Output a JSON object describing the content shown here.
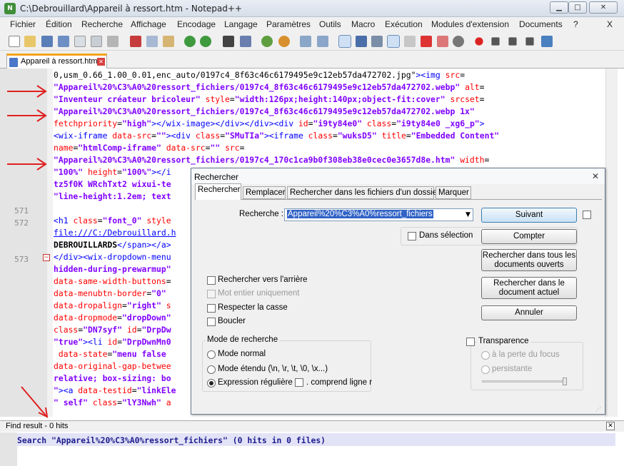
{
  "window": {
    "title": "C:\\Debrouillard\\Appareil à ressort.htm - Notepad++",
    "app_icon": "notepad-plus-plus-icon",
    "buttons": {
      "minimize": "▁",
      "maximize": "□",
      "close": "✕"
    }
  },
  "menu": [
    "Fichier",
    "Édition",
    "Recherche",
    "Affichage",
    "Encodage",
    "Langage",
    "Paramètres",
    "Outils",
    "Macro",
    "Exécution",
    "Modules d'extension",
    "Documents",
    "?"
  ],
  "menu_close": "X",
  "tabs": [
    {
      "label": "Appareil à ressort.htm",
      "close": "✕"
    }
  ],
  "gutter": [
    {
      "line": 7,
      "num": "571"
    },
    {
      "line": 8,
      "num": "572"
    },
    {
      "line": 10,
      "num": "573"
    }
  ],
  "editor": {
    "lines": [
      [
        {
          "t": "0,usm_0.66_1.00_0.01,enc_auto/0197c4_8f63c46c6179495e9c12eb57da472702.jpg\"",
          "c": "#000000"
        },
        {
          "t": "><img ",
          "c": "#0000ff"
        },
        {
          "t": "src",
          "c": "#ff0000"
        },
        {
          "t": "=",
          "c": "#000000"
        }
      ],
      [
        {
          "t": "\"Appareil%20%C3%A0%20ressort_fichiers/0197c4_8f63c46c6179495e9c12eb57da472702.webp\" ",
          "c": "#8000ff",
          "b": true
        },
        {
          "t": "alt",
          "c": "#ff0000"
        },
        {
          "t": "=",
          "c": "#000000"
        }
      ],
      [
        {
          "t": "\"Inventeur créateur bricoleur\" ",
          "c": "#8000ff",
          "b": true
        },
        {
          "t": "style",
          "c": "#ff0000"
        },
        {
          "t": "=",
          "c": "#000000"
        },
        {
          "t": "\"width:126px;height:140px;object-fit:cover\" ",
          "c": "#8000ff",
          "b": true
        },
        {
          "t": "srcset",
          "c": "#ff0000"
        },
        {
          "t": "=",
          "c": "#000000"
        }
      ],
      [
        {
          "t": "\"Appareil%20%C3%A0%20ressort_fichiers/0197c4_8f63c46c6179495e9c12eb57da472702.webp 1x\"",
          "c": "#8000ff",
          "b": true
        }
      ],
      [
        {
          "t": "fetchpriority",
          "c": "#ff0000"
        },
        {
          "t": "=",
          "c": "#000000"
        },
        {
          "t": "\"high\"",
          "c": "#8000ff",
          "b": true
        },
        {
          "t": "></wix-image></div></div><div ",
          "c": "#0000ff"
        },
        {
          "t": "id",
          "c": "#ff0000"
        },
        {
          "t": "=",
          "c": "#000000"
        },
        {
          "t": "\"i9ty84e0\" ",
          "c": "#8000ff",
          "b": true
        },
        {
          "t": "class",
          "c": "#ff0000"
        },
        {
          "t": "=",
          "c": "#000000"
        },
        {
          "t": "\"i9ty84e0 _xg6_p\"",
          "c": "#8000ff",
          "b": true
        },
        {
          "t": ">",
          "c": "#0000ff"
        }
      ],
      [
        {
          "t": "<wix-iframe ",
          "c": "#0000ff"
        },
        {
          "t": "data-src",
          "c": "#ff0000"
        },
        {
          "t": "=",
          "c": "#000000"
        },
        {
          "t": "\"\"",
          "c": "#8000ff",
          "b": true
        },
        {
          "t": "><div ",
          "c": "#0000ff"
        },
        {
          "t": "class",
          "c": "#ff0000"
        },
        {
          "t": "=",
          "c": "#000000"
        },
        {
          "t": "\"SMuTIa\"",
          "c": "#8000ff",
          "b": true
        },
        {
          "t": "><iframe ",
          "c": "#0000ff"
        },
        {
          "t": "class",
          "c": "#ff0000"
        },
        {
          "t": "=",
          "c": "#000000"
        },
        {
          "t": "\"wuksD5\" ",
          "c": "#8000ff",
          "b": true
        },
        {
          "t": "title",
          "c": "#ff0000"
        },
        {
          "t": "=",
          "c": "#000000"
        },
        {
          "t": "\"Embedded Content\"",
          "c": "#8000ff",
          "b": true
        }
      ],
      [
        {
          "t": "name",
          "c": "#ff0000"
        },
        {
          "t": "=",
          "c": "#000000"
        },
        {
          "t": "\"htmlComp-iframe\" ",
          "c": "#8000ff",
          "b": true
        },
        {
          "t": "data-src",
          "c": "#ff0000"
        },
        {
          "t": "=",
          "c": "#000000"
        },
        {
          "t": "\"\" ",
          "c": "#8000ff",
          "b": true
        },
        {
          "t": "src",
          "c": "#ff0000"
        },
        {
          "t": "=",
          "c": "#000000"
        }
      ],
      [
        {
          "t": "\"Appareil%20%C3%A0%20ressort_fichiers/0197c4_170c1ca9b0f308eb38e0cec0e3657d8e.htm\" ",
          "c": "#8000ff",
          "b": true
        },
        {
          "t": "width",
          "c": "#ff0000"
        },
        {
          "t": "=",
          "c": "#000000"
        }
      ],
      [
        {
          "t": "\"100%\" ",
          "c": "#8000ff",
          "b": true
        },
        {
          "t": "height",
          "c": "#ff0000"
        },
        {
          "t": "=",
          "c": "#000000"
        },
        {
          "t": "\"100%\"",
          "c": "#8000ff",
          "b": true
        },
        {
          "t": "></i",
          "c": "#0000ff"
        }
      ],
      [
        {
          "t": "tz5f0K WRchTxt2 wixui-te",
          "c": "#8000ff",
          "b": true
        }
      ],
      [
        {
          "t": "\"line-height:1.2em; text",
          "c": "#8000ff",
          "b": true
        }
      ],
      [],
      [
        {
          "t": "<h1 ",
          "c": "#0000ff"
        },
        {
          "t": "class",
          "c": "#ff0000"
        },
        {
          "t": "=",
          "c": "#000000"
        },
        {
          "t": "\"font_0\" ",
          "c": "#8000ff",
          "b": true
        },
        {
          "t": "style",
          "c": "#ff0000"
        }
      ],
      [
        {
          "t": "file:///C:/Debrouillard.h",
          "c": "#0000ff",
          "u": true
        }
      ],
      [
        {
          "t": "DEBROUILLARDS",
          "c": "#000000",
          "b": true
        },
        {
          "t": "</span></a>",
          "c": "#0000ff"
        }
      ],
      [
        {
          "t": "</div><wix-dropdown-menu",
          "c": "#0000ff"
        }
      ],
      [
        {
          "t": "hidden-during-prewarmup\"",
          "c": "#8000ff",
          "b": true
        }
      ],
      [
        {
          "t": "data-same-width-buttons",
          "c": "#ff0000"
        },
        {
          "t": "=",
          "c": "#000000"
        }
      ],
      [
        {
          "t": "data-menubtn-border",
          "c": "#ff0000"
        },
        {
          "t": "=",
          "c": "#000000"
        },
        {
          "t": "\"0\"",
          "c": "#8000ff",
          "b": true
        }
      ],
      [
        {
          "t": "data-dropalign",
          "c": "#ff0000"
        },
        {
          "t": "=",
          "c": "#000000"
        },
        {
          "t": "\"right\" ",
          "c": "#8000ff",
          "b": true
        },
        {
          "t": "s",
          "c": "#ff0000"
        }
      ],
      [
        {
          "t": "data-dropmode",
          "c": "#ff0000"
        },
        {
          "t": "=",
          "c": "#000000"
        },
        {
          "t": "\"dropDown\"",
          "c": "#8000ff",
          "b": true
        }
      ],
      [
        {
          "t": "class",
          "c": "#ff0000"
        },
        {
          "t": "=",
          "c": "#000000"
        },
        {
          "t": "\"DN7syf\" ",
          "c": "#8000ff",
          "b": true
        },
        {
          "t": "id",
          "c": "#ff0000"
        },
        {
          "t": "=",
          "c": "#000000"
        },
        {
          "t": "\"DrpDw",
          "c": "#8000ff",
          "b": true
        }
      ],
      [
        {
          "t": "\"true\"",
          "c": "#8000ff",
          "b": true
        },
        {
          "t": "><li ",
          "c": "#0000ff"
        },
        {
          "t": "id",
          "c": "#ff0000"
        },
        {
          "t": "=",
          "c": "#000000"
        },
        {
          "t": "\"DrpDwnMn0",
          "c": "#8000ff",
          "b": true
        }
      ],
      [
        {
          "t": " data-state",
          "c": "#ff0000"
        },
        {
          "t": "=",
          "c": "#000000"
        },
        {
          "t": "\"menu false",
          "c": "#8000ff",
          "b": true
        }
      ],
      [
        {
          "t": "data-original-gap-betwee",
          "c": "#ff0000"
        }
      ],
      [
        {
          "t": "relative; box-sizing: bo",
          "c": "#8000ff",
          "b": true
        }
      ],
      [
        {
          "t": "\"",
          "c": "#8000ff",
          "b": true
        },
        {
          "t": "><a ",
          "c": "#0000ff"
        },
        {
          "t": "data-testid",
          "c": "#ff0000"
        },
        {
          "t": "=",
          "c": "#000000"
        },
        {
          "t": "\"linkEle",
          "c": "#8000ff",
          "b": true
        }
      ],
      [
        {
          "t": "\" self\" ",
          "c": "#8000ff",
          "b": true
        },
        {
          "t": "class",
          "c": "#ff0000"
        },
        {
          "t": "=",
          "c": "#000000"
        },
        {
          "t": "\"lY3Nwh\" ",
          "c": "#8000ff",
          "b": true
        },
        {
          "t": "a",
          "c": "#ff0000"
        }
      ]
    ]
  },
  "find_result": {
    "label": "Find result - 0 hits",
    "close": "✕",
    "text": "Search \"Appareil%20%C3%A0%ressort_fichiers\" (0 hits in 0 files)"
  },
  "dialog": {
    "title": "Rechercher",
    "close": "✕",
    "tabs": [
      "Rechercher",
      "Remplacer",
      "Rechercher dans les fichiers d'un dossier",
      "Marquer"
    ],
    "search_label": "Recherche :",
    "search_value": "Appareil%20%C3%A0%ressort_fichiers",
    "dropdown_arrow": "▼",
    "in_selection": "Dans sélection",
    "buttons": {
      "next": "Suivant",
      "count": "Compter",
      "find_all_open_1": "Rechercher dans tous les",
      "find_all_open_2": "documents ouverts",
      "find_all_current_1": "Rechercher dans le",
      "find_all_current_2": "document actuel",
      "cancel": "Annuler"
    },
    "options": {
      "backward": "Rechercher vers l'arrière",
      "whole_word": "Mot entier uniquement",
      "match_case": "Respecter la casse",
      "wrap": "Boucler"
    },
    "mode": {
      "title": "Mode de recherche",
      "normal": "Mode normal",
      "extended": "Mode étendu (\\n, \\r, \\t, \\0, \\x...)",
      "regex": "Expression régulière",
      "newline": ". comprend ligne r",
      "selected": "regex"
    },
    "transparency": {
      "title": "Transparence",
      "on_blur": "à la perte du focus",
      "always": "persistante"
    },
    "grip": "⋰"
  }
}
